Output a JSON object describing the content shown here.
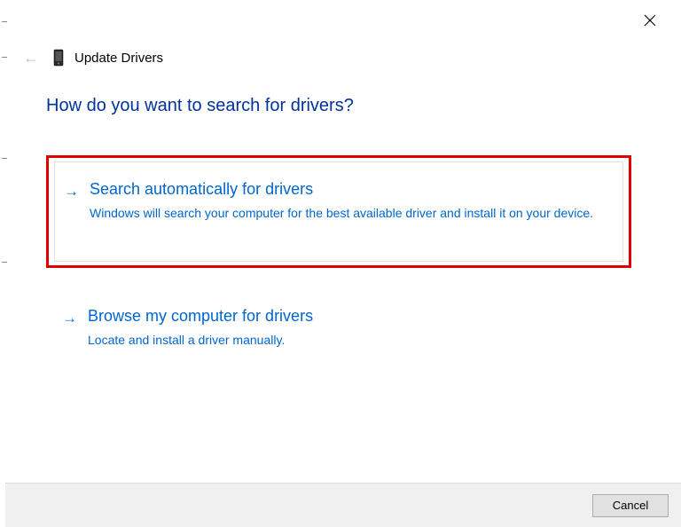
{
  "window": {
    "title": "Update Drivers"
  },
  "heading": "How do you want to search for drivers?",
  "options": [
    {
      "title": "Search automatically for drivers",
      "description": "Windows will search your computer for the best available driver and install it on your device."
    },
    {
      "title": "Browse my computer for drivers",
      "description": "Locate and install a driver manually."
    }
  ],
  "footer": {
    "cancel": "Cancel"
  }
}
